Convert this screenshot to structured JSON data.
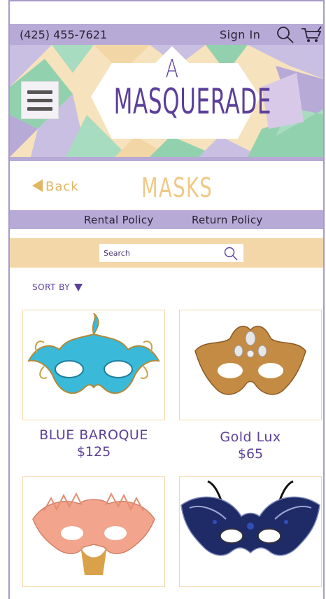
{
  "header": {
    "phone": "(425) 455-7621",
    "sign_in": "Sign In",
    "search_icon": "search-icon",
    "cart_icon": "cart-icon"
  },
  "banner": {
    "logo_line1": "A",
    "logo_line2": "MASQUERADE",
    "menu_icon": "hamburger-menu-icon",
    "colors": {
      "purple": "#b7aad6",
      "green": "#92d1ae",
      "peach": "#f4d7a8",
      "logo_text": "#5b3f9a"
    }
  },
  "page": {
    "back_label": "Back",
    "title": "MASKS"
  },
  "policies": {
    "rental": "Rental Policy",
    "return": "Return Policy"
  },
  "search": {
    "placeholder": "Search",
    "value": ""
  },
  "sort": {
    "label": "SORT BY"
  },
  "products": [
    {
      "name": "BLUE BAROQUE",
      "price": "$125",
      "color": "#36b6d6"
    },
    {
      "name": "Gold Lux",
      "price": "$65",
      "color": "#c08a3e"
    },
    {
      "name": "",
      "price": "",
      "color": "#f2a68a"
    },
    {
      "name": "",
      "price": "",
      "color": "#1f2b66"
    }
  ]
}
